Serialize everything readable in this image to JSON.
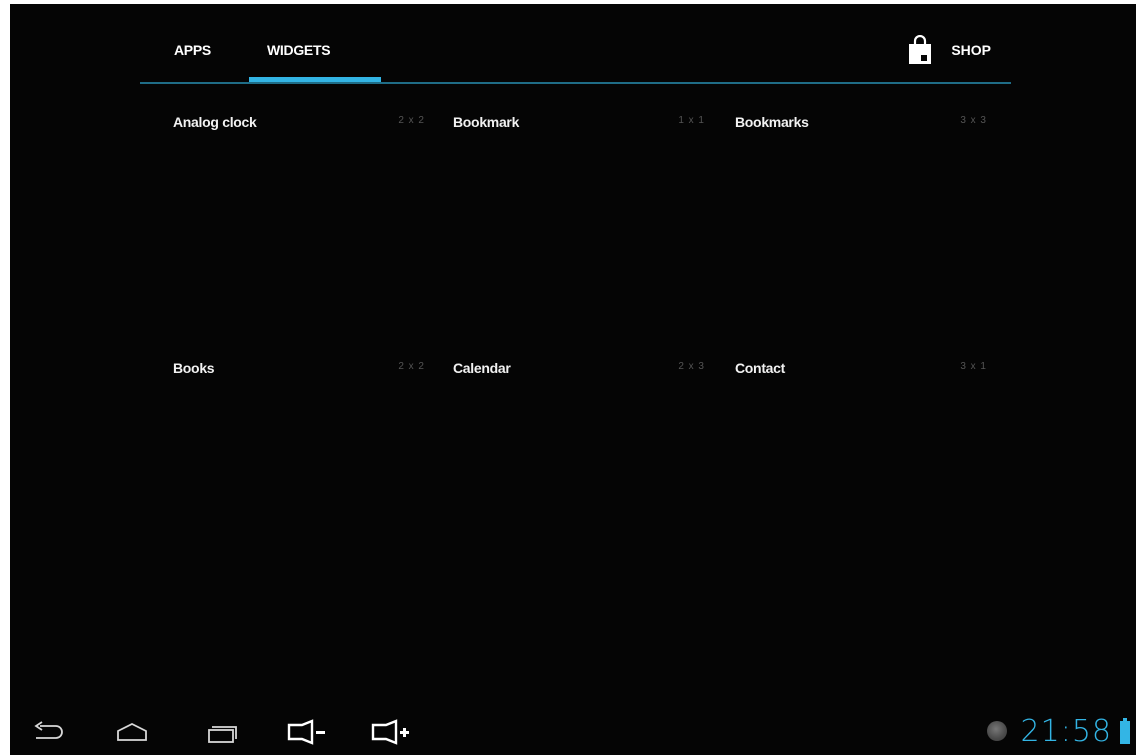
{
  "tabs": {
    "apps_label": "APPS",
    "widgets_label": "WIDGETS",
    "active": "WIDGETS",
    "shop_label": "SHOP"
  },
  "widgets": [
    {
      "name": "Analog clock",
      "size": "2 x 2"
    },
    {
      "name": "Bookmark",
      "size": "1 x 1"
    },
    {
      "name": "Bookmarks",
      "size": "3 x 3"
    },
    {
      "name": "Books",
      "size": "2 x 2"
    },
    {
      "name": "Calendar",
      "size": "2 x 3"
    },
    {
      "name": "Contact",
      "size": "3 x 1"
    }
  ],
  "navigation": {
    "back": "back-icon",
    "home": "home-icon",
    "recents": "recent-apps-icon",
    "volume_down": "volume-down-icon",
    "volume_up": "volume-up-icon"
  },
  "status": {
    "time": "21:58",
    "notification": "android-notification-icon",
    "battery": "battery-icon"
  },
  "colors": {
    "background": "#050505",
    "accent": "#33b5e5",
    "divider": "#1f6d87",
    "size_text": "#555555"
  }
}
